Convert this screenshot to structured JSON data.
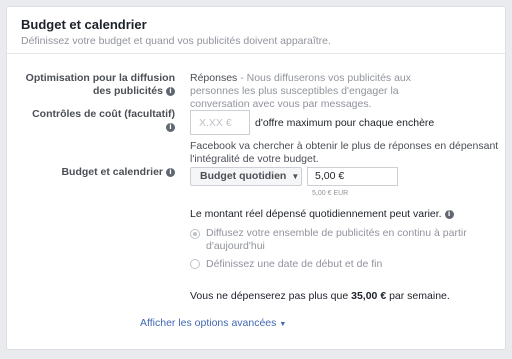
{
  "section": {
    "title": "Budget et calendrier",
    "subtitle": "Définissez votre budget et quand vos publicités doivent apparaître."
  },
  "optimization": {
    "label_line1": "Optimisation pour la diffusion",
    "label_line2": "des publicités",
    "value": "Réponses",
    "description_line1": " - Nous diffuserons vos publicités aux",
    "description_line2": "personnes les plus susceptibles d'engager la",
    "description_line3": "conversation avec vous par messages."
  },
  "cost_control": {
    "label": "Contrôles de coût (facultatif)",
    "placeholder": "X.XX €",
    "suffix": "d'offre maximum pour chaque enchère",
    "hint_line1": "Facebook va chercher à obtenir le plus de réponses en dépensant",
    "hint_line2": "l'intégralité de votre budget."
  },
  "budget": {
    "label": "Budget et calendrier",
    "type_selected": "Budget quotidien",
    "amount": "5,00 €",
    "amount_note": "5,00 € EUR",
    "variation_note": "Le montant réel dépensé quotidiennement peut varier."
  },
  "schedule": {
    "option1_line1": "Diffusez votre ensemble de publicités en continu à partir",
    "option1_line2": "d'aujourd'hui",
    "option1_selected": true,
    "option2": "Définissez une date de début et de fin"
  },
  "weekly": {
    "prefix": "Vous ne dépenserez pas plus que ",
    "amount": "35,00 €",
    "suffix": " par semaine."
  },
  "advanced_link": "Afficher les options avancées",
  "icons": {
    "info": "info-icon",
    "dropdown": "caret-down-icon",
    "advanced": "caret-down-icon"
  },
  "colors": {
    "link": "#4267b2",
    "label": "#4b4f56",
    "muted": "#90949c"
  }
}
